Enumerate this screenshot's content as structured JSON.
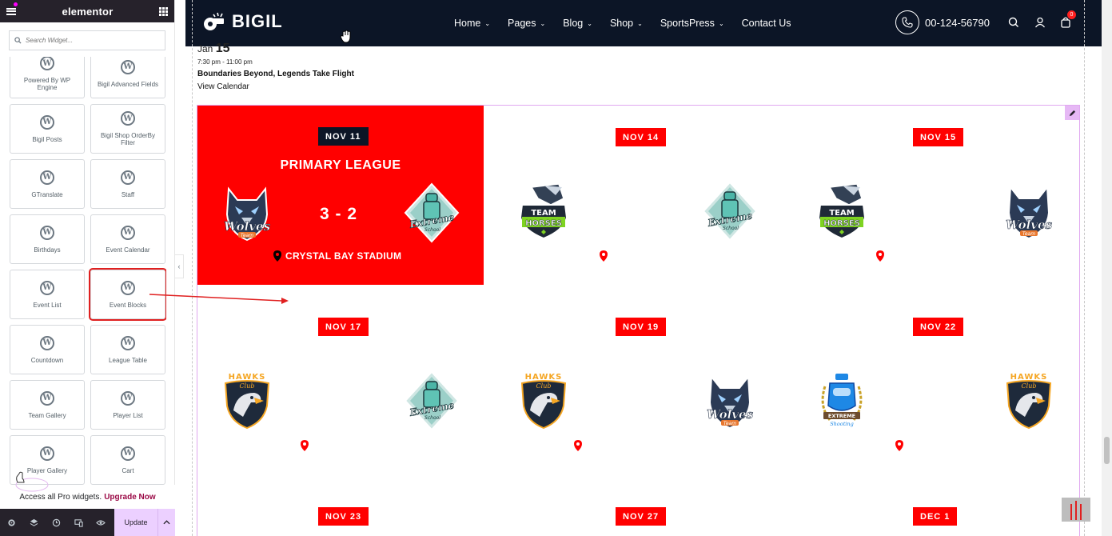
{
  "panel": {
    "title": "elementor",
    "search_placeholder": "Search Widget...",
    "widgets": [
      {
        "label": "Powered By WP Engine"
      },
      {
        "label": "Bigil Advanced Fields"
      },
      {
        "label": "Bigil Posts"
      },
      {
        "label": "Bigil Shop OrderBy Filter"
      },
      {
        "label": "GTranslate"
      },
      {
        "label": "Staff"
      },
      {
        "label": "Birthdays"
      },
      {
        "label": "Event Calendar"
      },
      {
        "label": "Event List"
      },
      {
        "label": "Event Blocks",
        "highlighted": true
      },
      {
        "label": "Countdown"
      },
      {
        "label": "League Table"
      },
      {
        "label": "Team Gallery"
      },
      {
        "label": "Player List"
      },
      {
        "label": "Player Gallery"
      },
      {
        "label": "Cart"
      }
    ],
    "pro_text": "Access all Pro widgets.",
    "pro_link": "Upgrade Now",
    "footer": {
      "update_label": "Update"
    }
  },
  "site": {
    "logo_text": "BIGIL",
    "nav": [
      {
        "label": "Home",
        "dropdown": true
      },
      {
        "label": "Pages",
        "dropdown": true
      },
      {
        "label": "Blog",
        "dropdown": true
      },
      {
        "label": "Shop",
        "dropdown": true
      },
      {
        "label": "SportsPress",
        "dropdown": true
      },
      {
        "label": "Contact Us",
        "dropdown": false
      }
    ],
    "phone": "00-124-56790",
    "cart_count": "0",
    "colors": {
      "header_bg": "#0c1526",
      "accent": "#ff0000"
    }
  },
  "event_top": {
    "month": "Jan",
    "day": "15",
    "time": "7:30 pm - 11:00 pm",
    "title": "Boundaries Beyond, Legends Take Flight",
    "view_calendar": "View Calendar"
  },
  "event_blocks": {
    "featured": {
      "date": "NOV 11",
      "league": "PRIMARY LEAGUE",
      "score": "3 - 2",
      "venue": "CRYSTAL BAY STADIUM",
      "home_team": "Wolves Team",
      "away_team": "Extreme School"
    },
    "events": [
      {
        "date": "NOV 14",
        "home": "Team Horses",
        "away": "Extreme School"
      },
      {
        "date": "NOV 15",
        "home": "Team Horses",
        "away": "Wolves Team"
      },
      {
        "date": "NOV 17",
        "home": "Hawks Club",
        "away": "Extreme School"
      },
      {
        "date": "NOV 19",
        "home": "Hawks Club",
        "away": "Wolves Team"
      },
      {
        "date": "NOV 22",
        "home": "Extreme Shooting",
        "away": "Hawks Club"
      },
      {
        "date": "NOV 23"
      },
      {
        "date": "NOV 27"
      },
      {
        "date": "DEC 1"
      }
    ],
    "logo_text": {
      "wolves_top": "Wolves",
      "wolves_sub": "Team",
      "extreme_top": "Extreme",
      "extreme_sub": "School",
      "horses_top": "TEAM",
      "horses_sub": "HORSES",
      "hawks_top": "HAWKS",
      "hawks_sub": "Club",
      "shooting_top": "EXTREME",
      "shooting_sub": "Shooting"
    }
  }
}
